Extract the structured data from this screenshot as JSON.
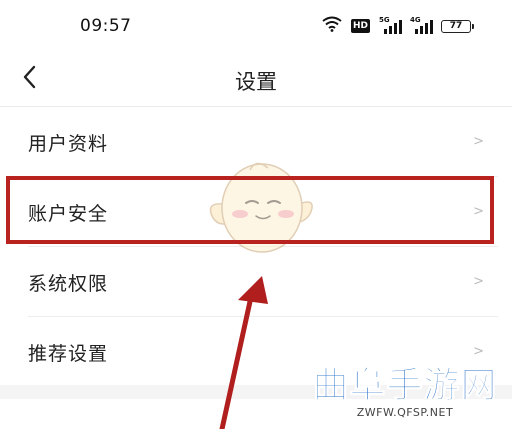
{
  "status_bar": {
    "time": "09:57",
    "hd_label": "HD",
    "signal1_label": "5G",
    "signal2_label": "4G",
    "battery_level": "77"
  },
  "nav": {
    "title": "设置"
  },
  "settings": {
    "items": [
      {
        "label": "用户资料"
      },
      {
        "label": "账户安全"
      },
      {
        "label": "系统权限"
      },
      {
        "label": "推荐设置"
      }
    ],
    "chevron_glyph": ">"
  },
  "colors": {
    "highlight": "#b8231f",
    "watermark": "#2a73c6"
  },
  "icons": [
    "back-arrow-icon",
    "wifi-icon",
    "hd-icon",
    "signal-icon",
    "battery-icon",
    "chevron-right-icon",
    "mascot-sticker",
    "annotation-arrow"
  ],
  "watermark": {
    "title": "曲阜手游网",
    "url": "ZWFW.QFSP.NET"
  }
}
